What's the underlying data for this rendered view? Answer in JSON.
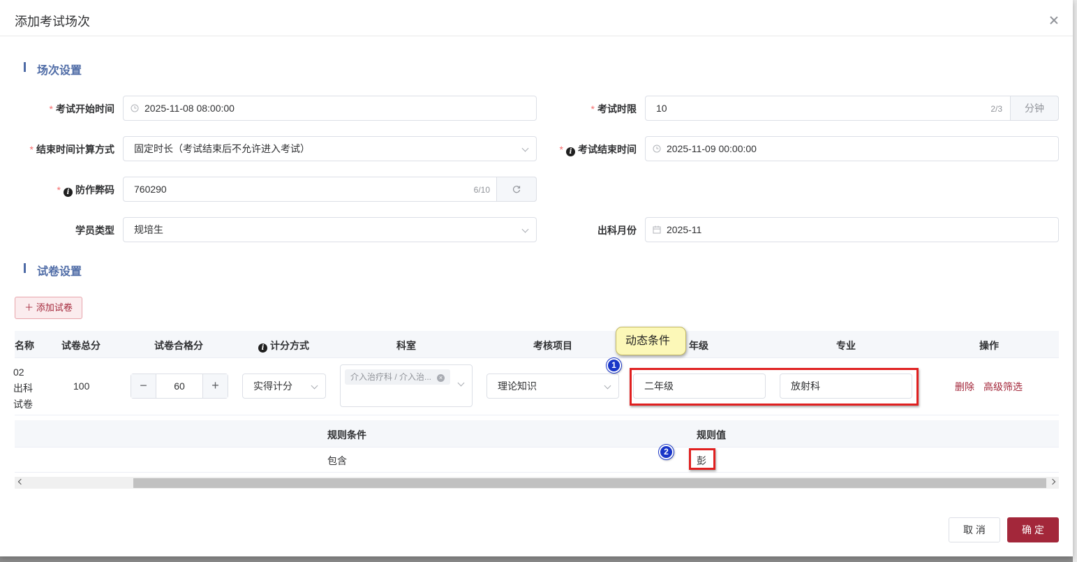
{
  "dialog": {
    "title": "添加考试场次"
  },
  "sections": {
    "session": "场次设置",
    "paper": "试卷设置"
  },
  "form": {
    "start_time": {
      "label": "考试开始时间",
      "value": "2025-11-08 08:00:00"
    },
    "time_limit": {
      "label": "考试时限",
      "value": "10",
      "counter": "2/3",
      "unit": "分钟"
    },
    "end_calc": {
      "label": "结束时间计算方式",
      "value": "固定时长（考试结束后不允许进入考试）"
    },
    "end_time": {
      "label": "考试结束时间",
      "value": "2025-11-09 00:00:00"
    },
    "anti_cheat": {
      "label": "防作弊码",
      "value": "760290",
      "counter": "6/10"
    },
    "student_type": {
      "label": "学员类型",
      "value": "规培生"
    },
    "dept_month": {
      "label": "出科月份",
      "value": "2025-11"
    }
  },
  "add_paper_button": "添加试卷",
  "table": {
    "headers": {
      "name": "名称",
      "total": "试卷总分",
      "pass": "试卷合格分",
      "scoring": "计分方式",
      "dept": "科室",
      "item": "考核项目",
      "grade": "年级",
      "major": "专业",
      "ops": "操作"
    },
    "row": {
      "name_lines": [
        "02",
        "出科",
        "试卷"
      ],
      "total": "100",
      "pass": "60",
      "scoring": "实得计分",
      "dept_tag": "介入治疗科 / 介入治...",
      "item": "理论知识",
      "grade": "二年级",
      "major": "放射科",
      "delete": "删除",
      "advanced": "高级筛选"
    }
  },
  "sub_table": {
    "headers": {
      "condition": "规则条件",
      "value": "规则值"
    },
    "row": {
      "condition": "包含",
      "value": "彭"
    }
  },
  "annotations": {
    "tooltip": "动态条件",
    "badge1": "1",
    "badge2": "2"
  },
  "footer": {
    "cancel": "取 消",
    "ok": "确 定"
  }
}
